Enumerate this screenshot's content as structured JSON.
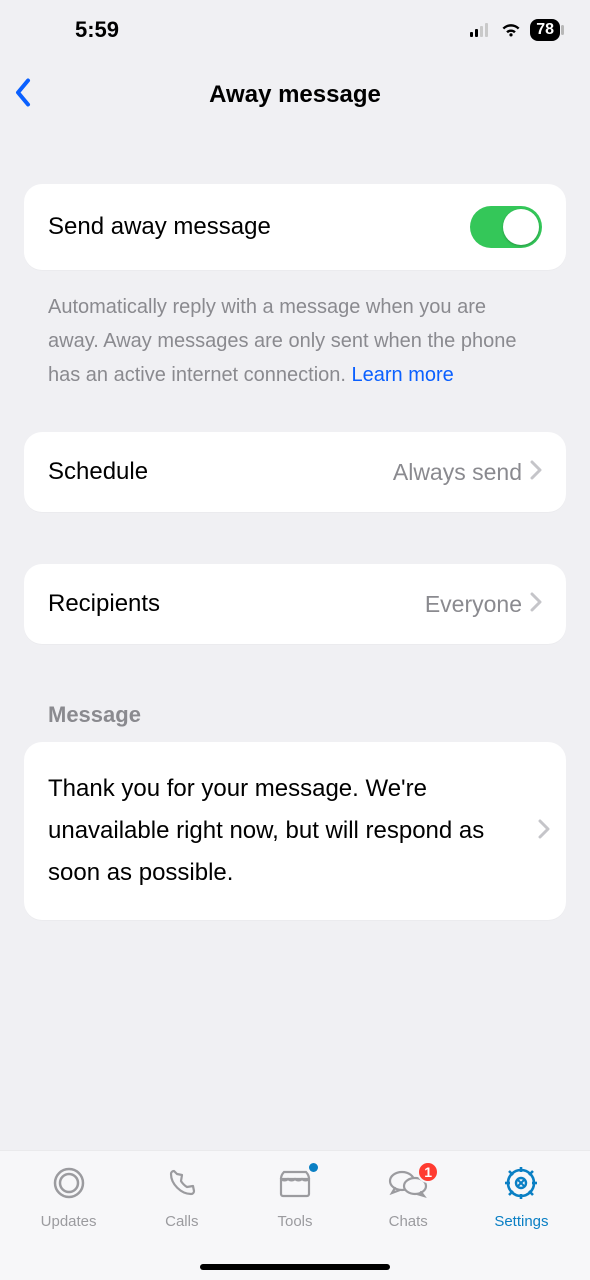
{
  "status": {
    "time": "5:59",
    "battery": "78"
  },
  "header": {
    "title": "Away message"
  },
  "toggle_card": {
    "label": "Send away message",
    "on": true
  },
  "help": {
    "text": "Automatically reply with a message when you are away. Away messages are only sent when the phone has an active internet connection. ",
    "learn_more": "Learn more"
  },
  "schedule": {
    "label": "Schedule",
    "value": "Always send"
  },
  "recipients": {
    "label": "Recipients",
    "value": "Everyone"
  },
  "message_section": {
    "title": "Message"
  },
  "message_card": {
    "text": "Thank you for your message. We're unavailable right now, but will respond as soon as possible."
  },
  "tabs": {
    "updates": "Updates",
    "calls": "Calls",
    "tools": "Tools",
    "chats": "Chats",
    "chats_badge": "1",
    "settings": "Settings"
  }
}
